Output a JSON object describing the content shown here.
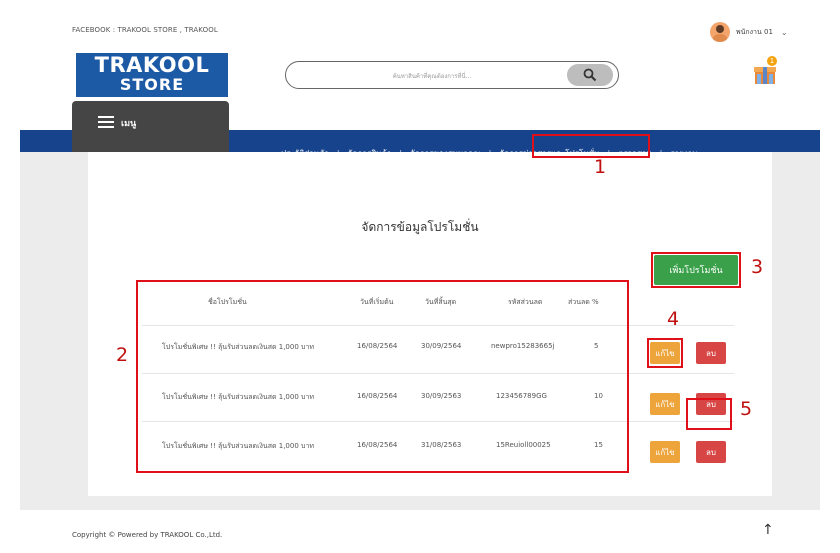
{
  "header": {
    "facebook_text": "FACEBOOK : TRAKOOL STORE , TRAKOOL",
    "user_name": "พนักงาน 01",
    "logo_line1": "TRAKOOL",
    "logo_line2": "STORE",
    "search_placeholder": "ค้นหาสินค้าที่คุณต้องการที่นี่...",
    "cart_count": "1",
    "menu_label": "เมนู"
  },
  "nav": {
    "items": [
      "ประวัติส่วนตัว",
      "จัดการสินค้า",
      "จัดการของสมนาคุณ",
      "จัดการข่าวสารและโปรโมชั่น",
      "ตรวจสอบ",
      "รายงาน"
    ]
  },
  "page": {
    "title": "จัดการข้อมูลโปรโมชั่น",
    "add_button": "เพิ่มโปรโมชั่น"
  },
  "table": {
    "headers": [
      "ชื่อโปรโมชั่น",
      "วันที่เริ่มต้น",
      "วันที่สิ้นสุด",
      "รหัสส่วนลด",
      "ส่วนลด %"
    ],
    "rows": [
      [
        "โปรโมชั่นพิเศษ !! ลุ้นรับส่วนลดเงินสด 1,000 บาท",
        "16/08/2564",
        "30/09/2564",
        "newpro15283665j",
        "5"
      ],
      [
        "โปรโมชั่นพิเศษ !! ลุ้นรับส่วนลดเงินสด 1,000 บาท",
        "16/08/2564",
        "30/09/2563",
        "123456789GG",
        "10"
      ],
      [
        "โปรโมชั่นพิเศษ !! ลุ้นรับส่วนลดเงินสด 1,000 บาท",
        "16/08/2564",
        "31/08/2563",
        "15Reuioll00025",
        "15"
      ]
    ],
    "edit_label": "แก้ไข",
    "delete_label": "ลบ"
  },
  "annotations": [
    "1",
    "2",
    "3",
    "4",
    "5"
  ],
  "footer": {
    "copyright": "Copyright © Powered by TRAKOOL Co.,Ltd.",
    "up_arrow": "↑"
  },
  "colors": {
    "nav_blue": "#17438c",
    "logo_blue": "#1d5aa5",
    "add_green": "#3aa14a",
    "edit_orange": "#eca43b",
    "delete_red": "#d84545",
    "annotation_red": "#e0101a"
  }
}
